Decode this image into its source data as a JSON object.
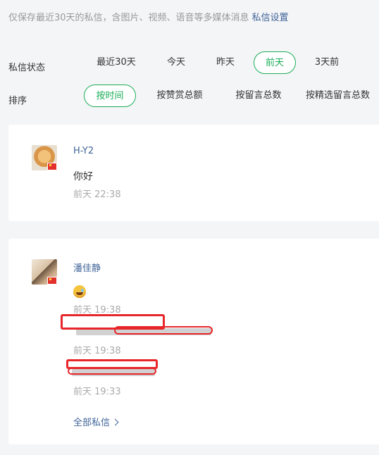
{
  "notice": {
    "text": "仅保存最近30天的私信，含图片、视频、语音等多媒体消息",
    "link": "私信设置"
  },
  "status_filter": {
    "label": "私信状态",
    "options": [
      "最近30天",
      "今天",
      "昨天",
      "前天",
      "3天前"
    ],
    "selected": "前天"
  },
  "sort_filter": {
    "label": "排序",
    "options": [
      "按时间",
      "按赞赏总额",
      "按留言总数",
      "按精选留言总数"
    ],
    "selected": "按时间"
  },
  "conversations": [
    {
      "sender": "H-Y2",
      "messages": [
        {
          "text": "你好",
          "time": "前天 22:38"
        }
      ]
    },
    {
      "sender": "潘佳静",
      "messages": [
        {
          "type": "emoji",
          "icon": "laughing-tears-emoji-icon",
          "time": "前天 19:38"
        },
        {
          "text": "",
          "redacted": true,
          "time": "前天 19:38"
        },
        {
          "text": "",
          "redacted": true,
          "time": "前天 19:33"
        }
      ],
      "all_link": "全部私信"
    }
  ],
  "colors": {
    "accent_green": "#1aad57",
    "link_blue": "#406599",
    "redaction_red": "#e8262a"
  }
}
